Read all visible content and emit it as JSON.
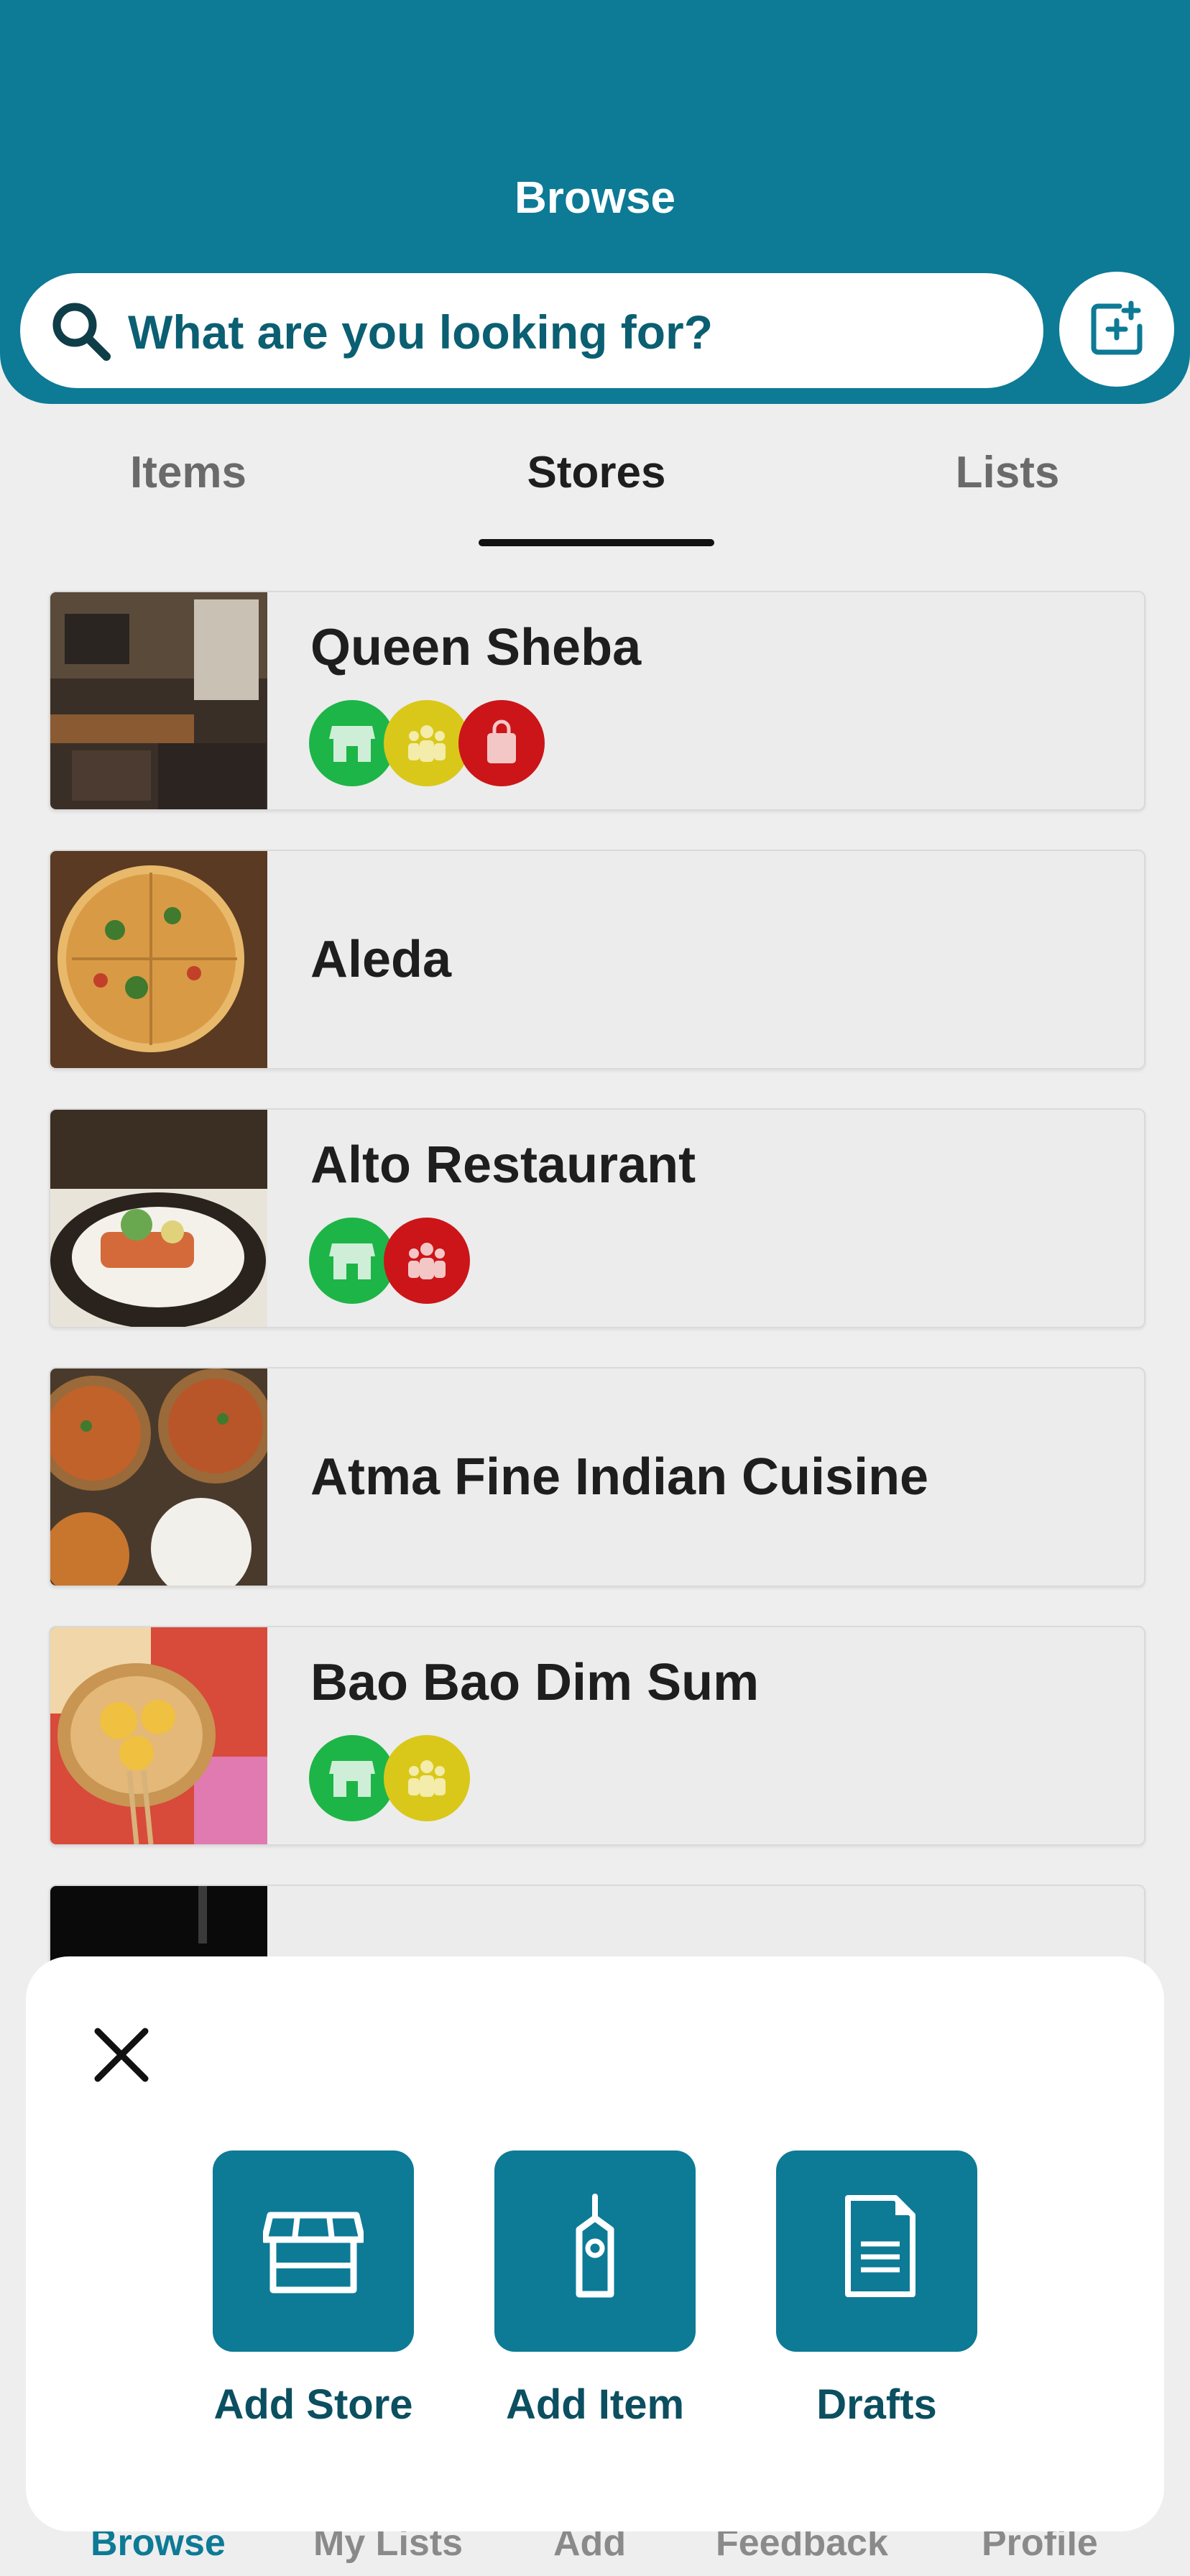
{
  "header": {
    "title": "Browse"
  },
  "search": {
    "placeholder": "What are you looking for?"
  },
  "tabs": [
    {
      "label": "Items",
      "active": false
    },
    {
      "label": "Stores",
      "active": true
    },
    {
      "label": "Lists",
      "active": false
    }
  ],
  "stores": [
    {
      "name": "Queen Sheba",
      "badges": [
        "storefront-icon:green",
        "group-icon:yellow",
        "bag-icon:red"
      ]
    },
    {
      "name": "Aleda",
      "badges": []
    },
    {
      "name": "Alto Restaurant",
      "badges": [
        "storefront-icon:green",
        "group-icon:red"
      ]
    },
    {
      "name": "Atma Fine Indian Cuisine",
      "badges": []
    },
    {
      "name": "Bao Bao Dim Sum",
      "badges": [
        "storefront-icon:green",
        "group-icon:yellow"
      ]
    },
    {
      "name": "",
      "badges": []
    }
  ],
  "sheet": {
    "actions": [
      {
        "label": "Add Store",
        "icon": "storefront-icon"
      },
      {
        "label": "Add Item",
        "icon": "tag-icon"
      },
      {
        "label": "Drafts",
        "icon": "document-icon"
      }
    ]
  },
  "bottom_nav": [
    "Browse",
    "My Lists",
    "Add",
    "Feedback",
    "Profile"
  ],
  "colors": {
    "primary": "#0d7a96",
    "badge_green": "#1db547",
    "badge_yellow": "#d9c81a",
    "badge_red": "#cc1518"
  }
}
